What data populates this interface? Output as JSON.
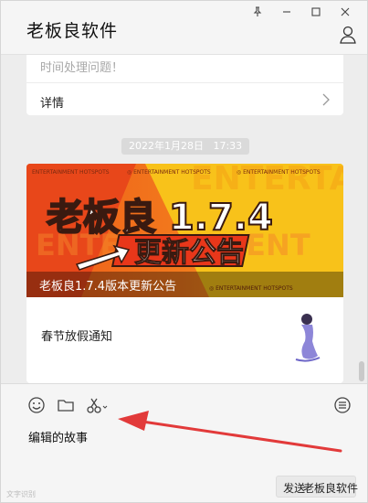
{
  "window": {
    "title": "老板良软件",
    "controls": [
      "pin-icon",
      "minimize-icon",
      "maximize-icon",
      "close-icon"
    ]
  },
  "chat": {
    "card1": {
      "text": "时间处理问题！",
      "link_label": "详情"
    },
    "timestamp": "2022年1月28日   17:33",
    "card2": {
      "banner_caption": "老板良1.7.4版本更新公告",
      "banner_headline": "老板良 1.7.4",
      "banner_subheadline": "更新公告",
      "banner_tagline": "ENTERTAINMENT HOTSPOTS",
      "item_title": "春节放假通知"
    }
  },
  "input": {
    "tools": [
      "emoji-icon",
      "folder-icon",
      "scissors-icon"
    ],
    "draft_text": "编辑的故事",
    "send_label": "发送",
    "overlay_text": "老板良软件",
    "watermark": "文字识别"
  },
  "colors": {
    "banner_orange": "#f06a1c",
    "banner_yellow": "#f8c21a",
    "arrow_red": "#e23a3a"
  }
}
